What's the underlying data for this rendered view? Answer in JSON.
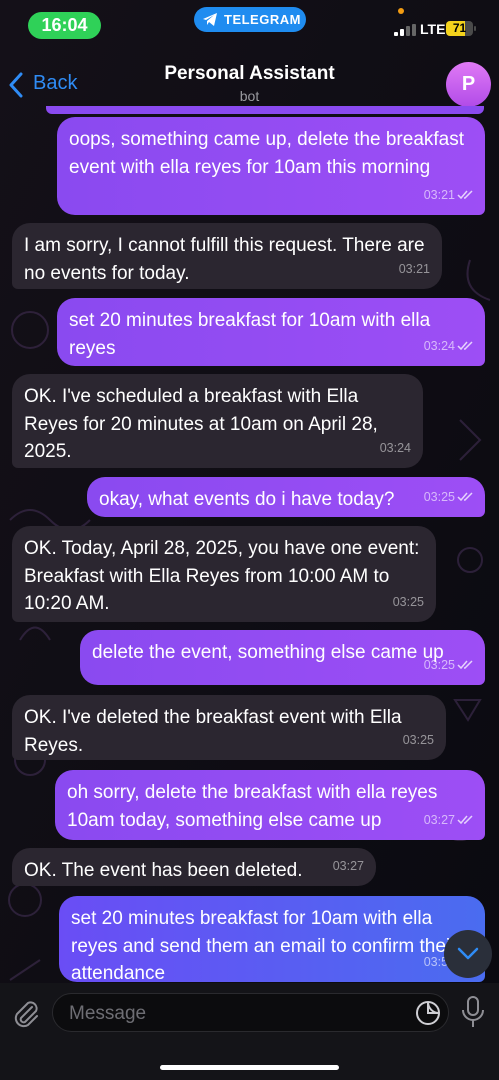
{
  "status_bar": {
    "time": "16:04",
    "app_pill": "TELEGRAM",
    "network": "LTE",
    "battery": "71",
    "battery_level": 0.71
  },
  "header": {
    "back_label": "Back",
    "title": "Personal Assistant",
    "subtitle": "bot",
    "avatar_letter": "P"
  },
  "messages": [
    {
      "direction": "out",
      "text": "oops, something came up, delete the breakfast event with ella reyes for 10am this morning",
      "time": "03:21",
      "read": true
    },
    {
      "direction": "in",
      "text": "I am sorry, I cannot fulfill this request. There are no events for today.",
      "time": "03:21"
    },
    {
      "direction": "out",
      "text": "set  20 minutes breakfast for 10am with ella reyes",
      "time": "03:24",
      "read": true
    },
    {
      "direction": "in",
      "text": "OK. I've scheduled a breakfast with Ella Reyes for 20 minutes at 10am on April 28, 2025.",
      "time": "03:24"
    },
    {
      "direction": "out",
      "text": "okay, what events do i have today?",
      "time": "03:25",
      "read": true
    },
    {
      "direction": "in",
      "text": "OK. Today, April 28, 2025, you have one event: Breakfast with Ella Reyes from 10:00 AM to 10:20 AM.",
      "time": "03:25"
    },
    {
      "direction": "out",
      "text": "delete the event, something else came up",
      "time": "03:25",
      "read": true
    },
    {
      "direction": "in",
      "text": "OK. I've deleted the breakfast event with Ella Reyes.",
      "time": "03:25"
    },
    {
      "direction": "out",
      "text": "oh sorry, delete the breakfast with ella reyes 10am today, something else came up",
      "time": "03:27",
      "read": true
    },
    {
      "direction": "in",
      "text": "OK. The event has been deleted.",
      "time": "03:27"
    },
    {
      "direction": "out",
      "text": "set  20 minutes breakfast for 10am with ella reyes and send them an email to confirm their attendance",
      "time": "03:55",
      "read": true
    }
  ],
  "input": {
    "placeholder": "Message"
  },
  "colors": {
    "outgoing_bubble": "#8a4af0",
    "incoming_bubble": "#2b2630",
    "accent": "#2f8cf5",
    "time_pill": "#2fd158"
  }
}
